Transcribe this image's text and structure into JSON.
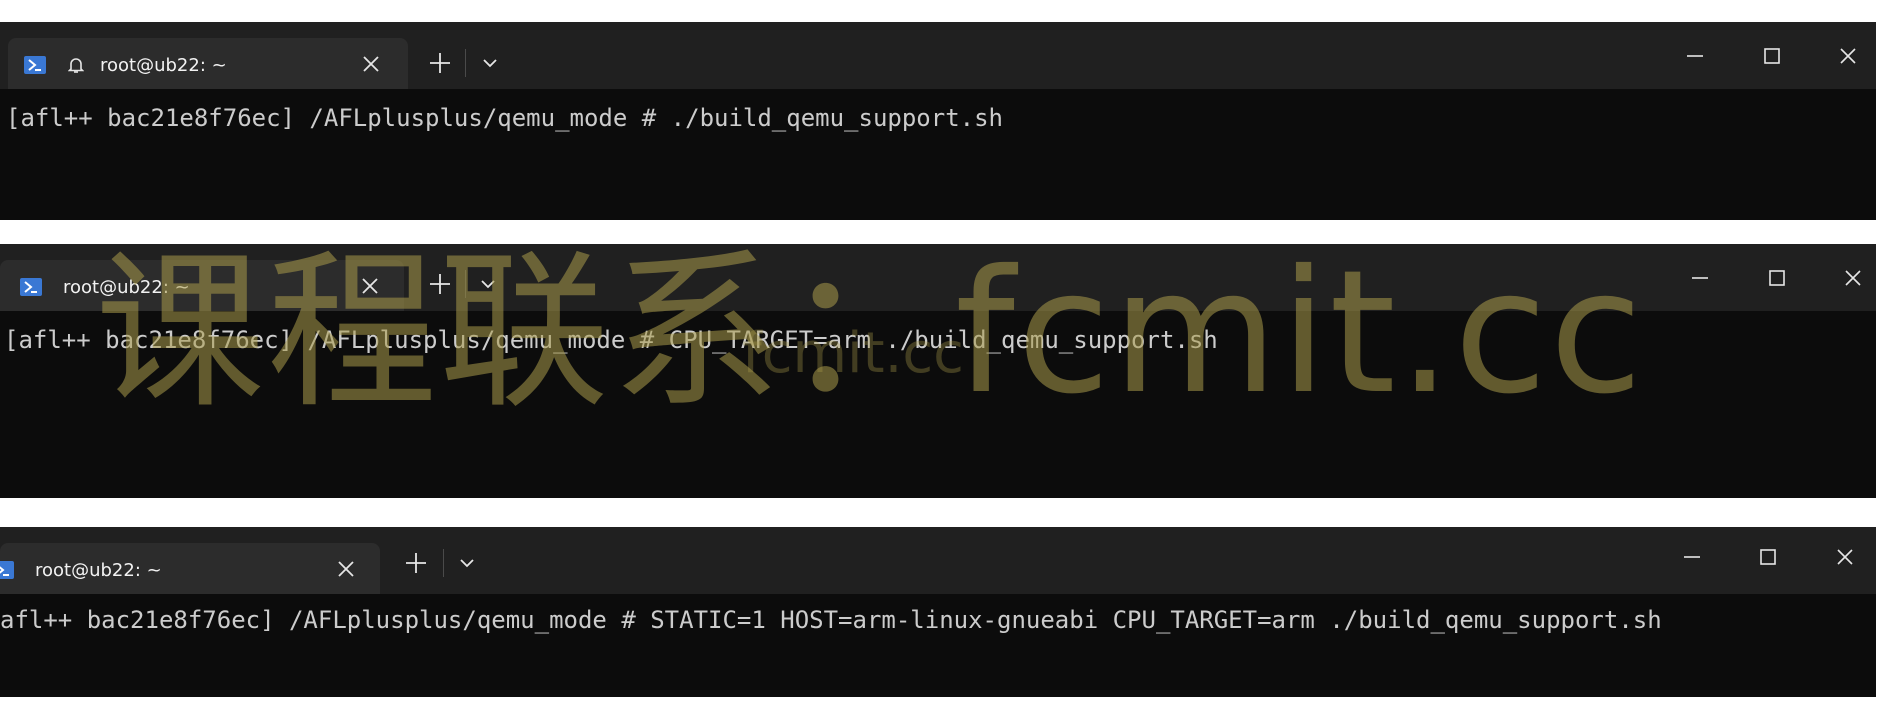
{
  "windows": [
    {
      "tab_title": "root@ub22: ~",
      "command": "[afl++ bac21e8f76ec] /AFLplusplus/qemu_mode # ./build_qemu_support.sh"
    },
    {
      "tab_title": "root@ub22: ~",
      "command": "[afl++ bac21e8f76ec] /AFLplusplus/qemu_mode # CPU_TARGET=arm ./build_qemu_support.sh"
    },
    {
      "tab_title": "root@ub22: ~",
      "command": "afl++ bac21e8f76ec] /AFLplusplus/qemu_mode # STATIC=1 HOST=arm-linux-gnueabi CPU_TARGET=arm ./build_qemu_support.sh"
    }
  ],
  "watermark": {
    "text": "课程联系：fcmit.cc",
    "echo": "fcmit.cc"
  },
  "colors": {
    "terminal_bg": "#0c0c0c",
    "titlebar_bg": "#202020",
    "tab_bg": "#2c2c2c",
    "text": "#cccccc",
    "powershell_icon": "#3a78d4",
    "watermark": "#aa9b4b"
  },
  "icons": {
    "tab_icon": "powershell-icon",
    "bell": "bell-icon",
    "close_tab": "close-icon",
    "new_tab": "plus-icon",
    "dropdown": "chevron-down-icon",
    "minimize": "minimize-icon",
    "maximize": "maximize-icon",
    "close_window": "close-icon"
  }
}
